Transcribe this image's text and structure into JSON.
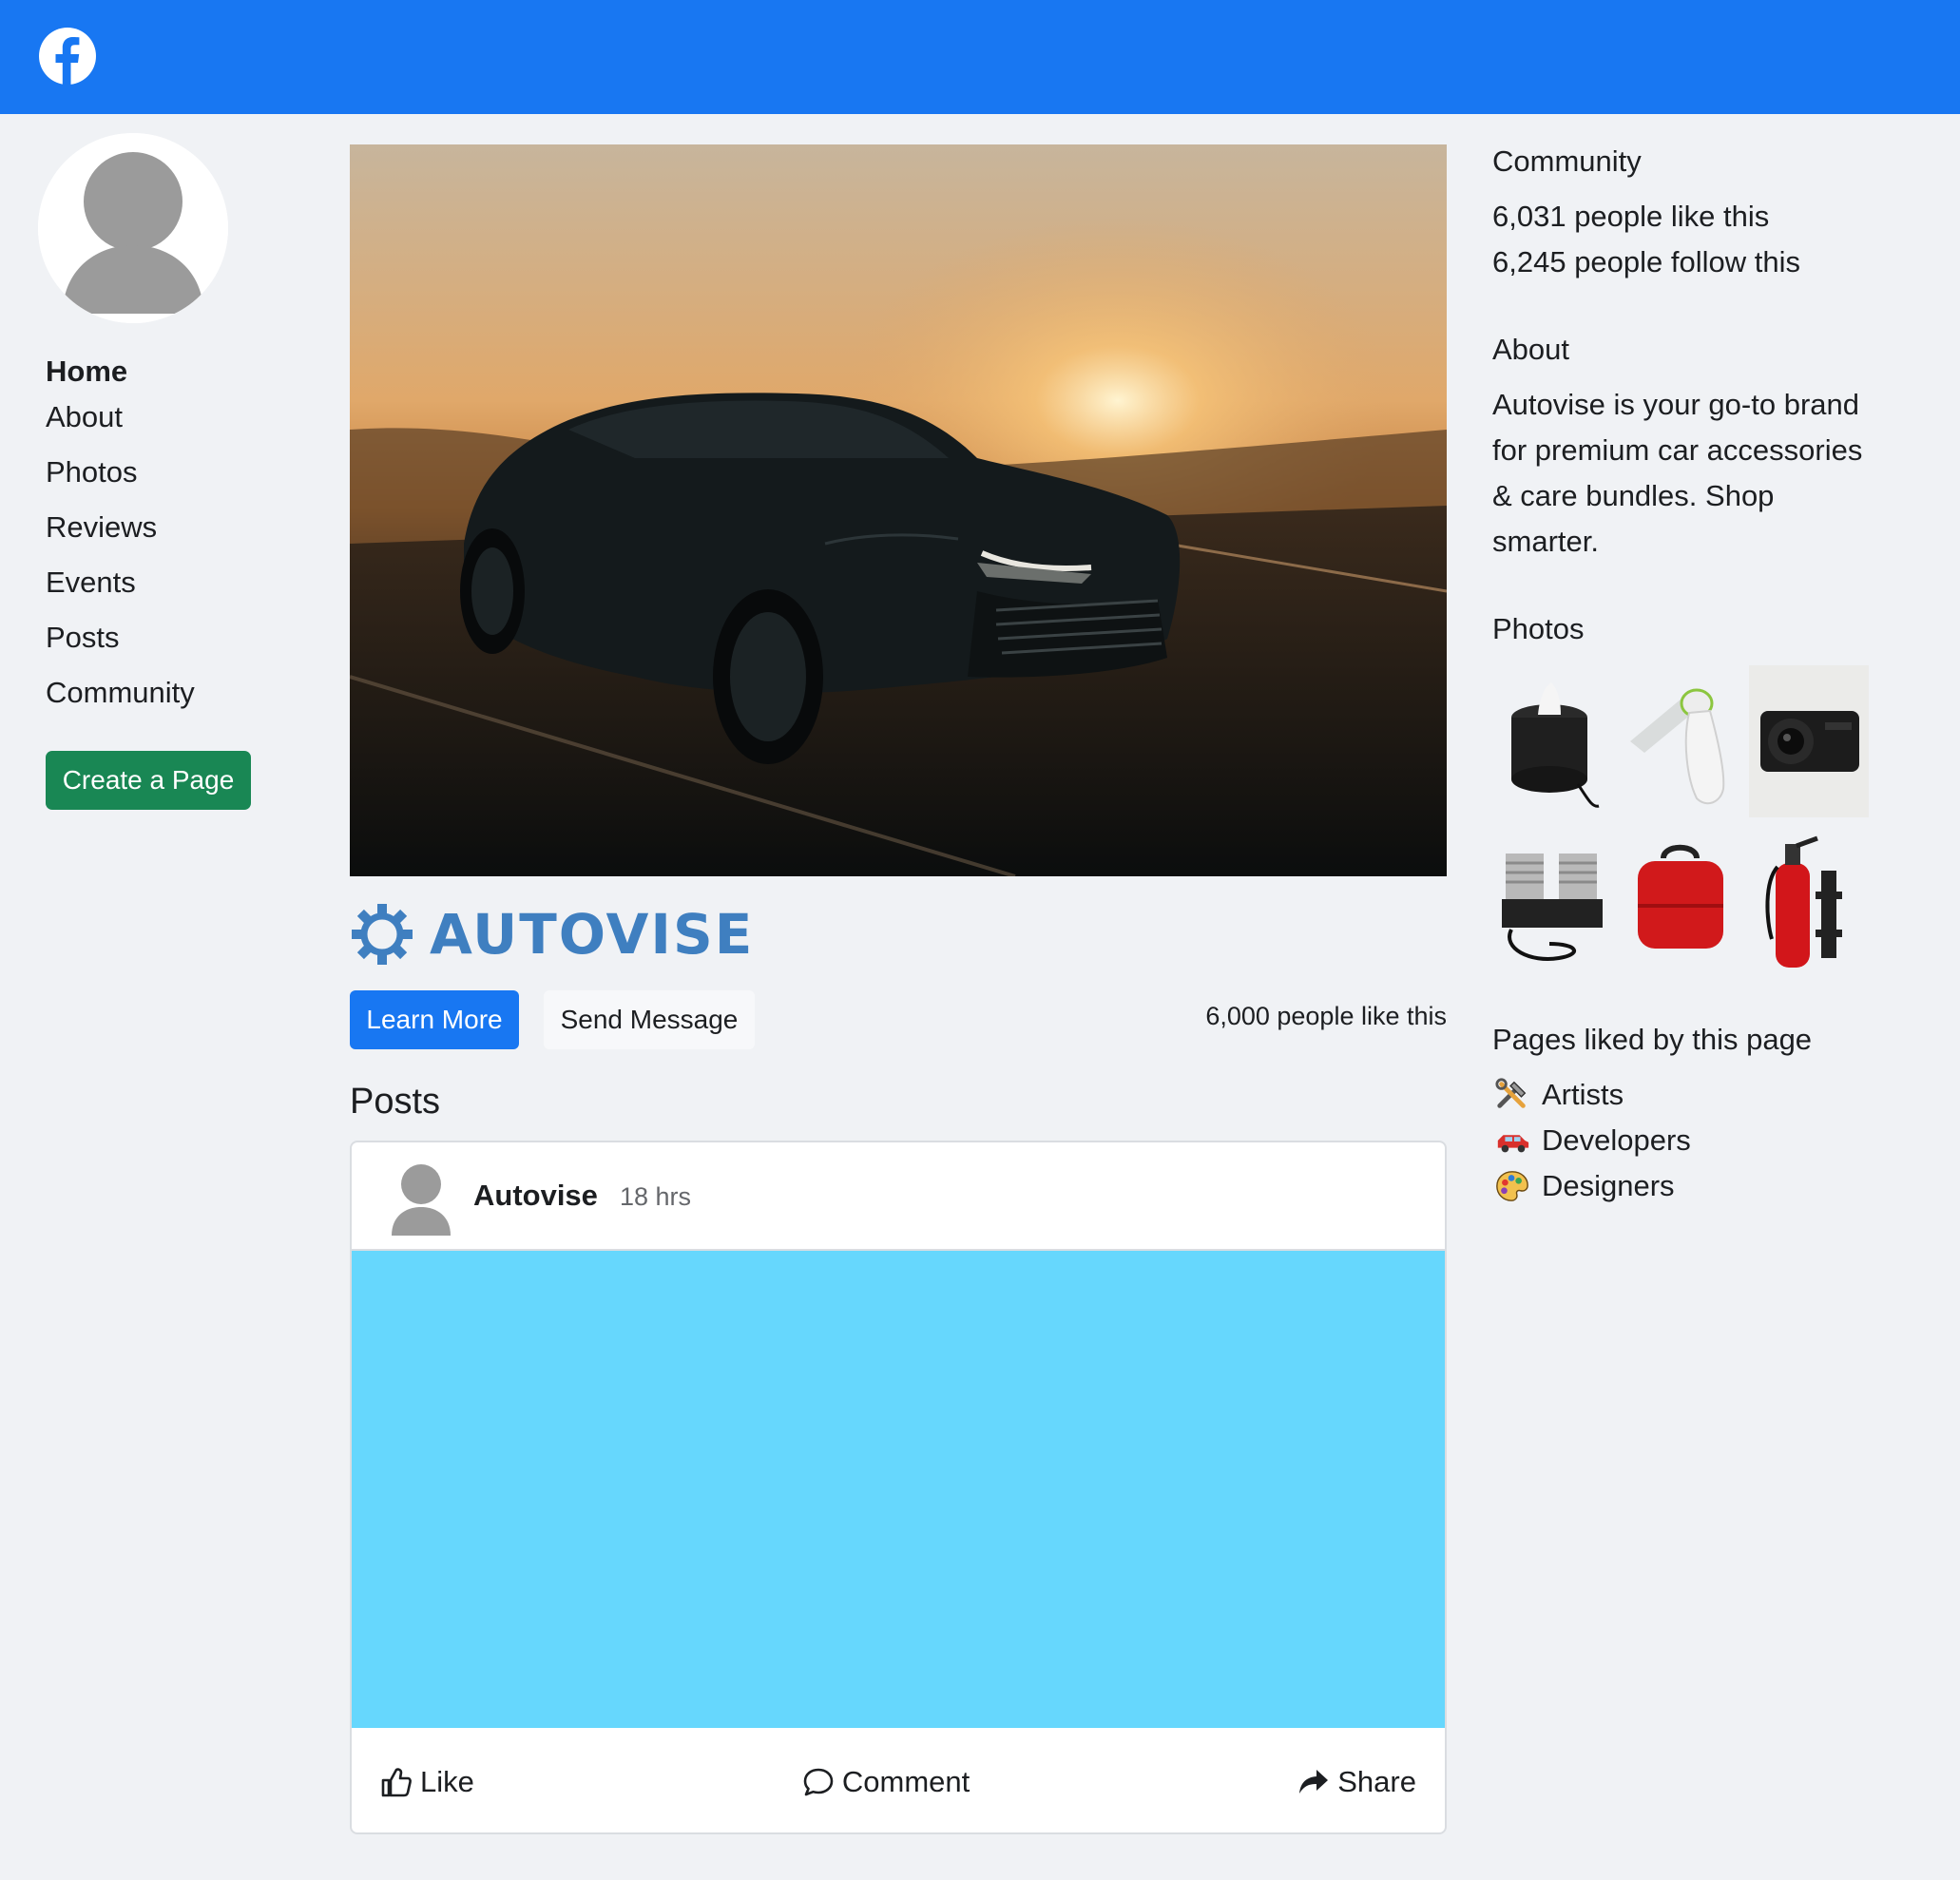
{
  "colors": {
    "topbar": "#1877f2",
    "background": "#f0f2f5",
    "create_button": "#198754",
    "learn_button": "#1877f2",
    "brand": "#3f7fc0",
    "post_media": "#66d7fd"
  },
  "sidebar": {
    "items": [
      {
        "label": "Home",
        "active": true
      },
      {
        "label": "About"
      },
      {
        "label": "Photos"
      },
      {
        "label": "Reviews"
      },
      {
        "label": "Events"
      },
      {
        "label": "Posts"
      },
      {
        "label": "Community"
      }
    ],
    "create_page_label": "Create a Page"
  },
  "page": {
    "brand_name": "AUTOVISE",
    "learn_more_label": "Learn More",
    "send_message_label": "Send Message",
    "likes_text": "6,000 people like this",
    "posts_heading": "Posts"
  },
  "post": {
    "author": "Autovise",
    "time": "18 hrs",
    "actions": {
      "like": "Like",
      "comment": "Comment",
      "share": "Share"
    }
  },
  "right": {
    "community_heading": "Community",
    "likes_line": "6,031 people like this",
    "follows_line": "6,245 people follow this",
    "about_heading": "About",
    "about_text": "Autovise is your go-to brand for premium car accessories & care bundles. Shop smarter.",
    "photos_heading": "Photos",
    "photos": [
      {
        "icon": "tissue-holder"
      },
      {
        "icon": "car-vacuum"
      },
      {
        "icon": "dash-camera"
      },
      {
        "icon": "air-compressor"
      },
      {
        "icon": "red-case"
      },
      {
        "icon": "fire-extinguisher"
      }
    ],
    "liked_heading": "Pages liked by this page",
    "liked_pages": [
      {
        "label": "Artists",
        "icon": "tools-icon"
      },
      {
        "label": "Developers",
        "icon": "car-icon"
      },
      {
        "label": "Designers",
        "icon": "palette-icon"
      }
    ]
  }
}
